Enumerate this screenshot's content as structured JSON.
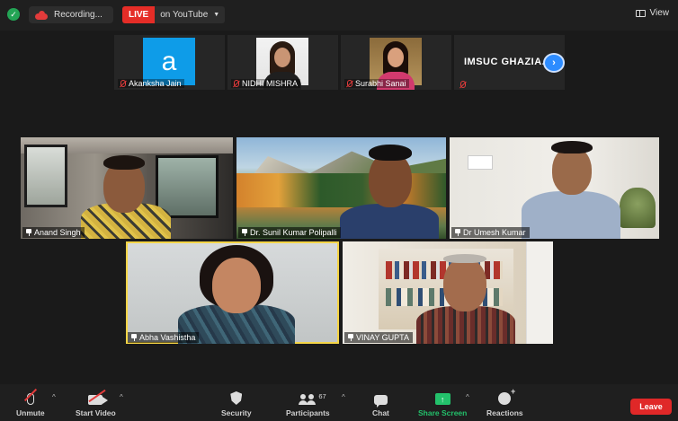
{
  "topbar": {
    "recording_label": "Recording...",
    "live_badge": "LIVE",
    "live_destination": "on YouTube",
    "view_label": "View"
  },
  "thumbnails": [
    {
      "name": "Akanksha Jain",
      "avatar_letter": "a"
    },
    {
      "name": "NIDHI MISHRA"
    },
    {
      "name": "Surabhi Sanai"
    },
    {
      "title": "IMSUC GHAZIA..."
    }
  ],
  "gallery": [
    {
      "name": "Anand Singh"
    },
    {
      "name": "Dr. Sunil Kumar Polipalli"
    },
    {
      "name": "Dr Umesh Kumar"
    },
    {
      "name": "Abha Vashistha"
    },
    {
      "name": "VINAY GUPTA"
    }
  ],
  "toolbar": {
    "unmute": "Unmute",
    "start_video": "Start Video",
    "security": "Security",
    "participants": "Participants",
    "participants_count": "67",
    "chat": "Chat",
    "share_screen": "Share Screen",
    "reactions": "Reactions",
    "leave": "Leave"
  },
  "colors": {
    "live_red": "#e52d27",
    "share_green": "#23c16b",
    "leave_red": "#e02828",
    "speaker_highlight": "#f5d547",
    "accent_blue": "#2d8cff"
  }
}
